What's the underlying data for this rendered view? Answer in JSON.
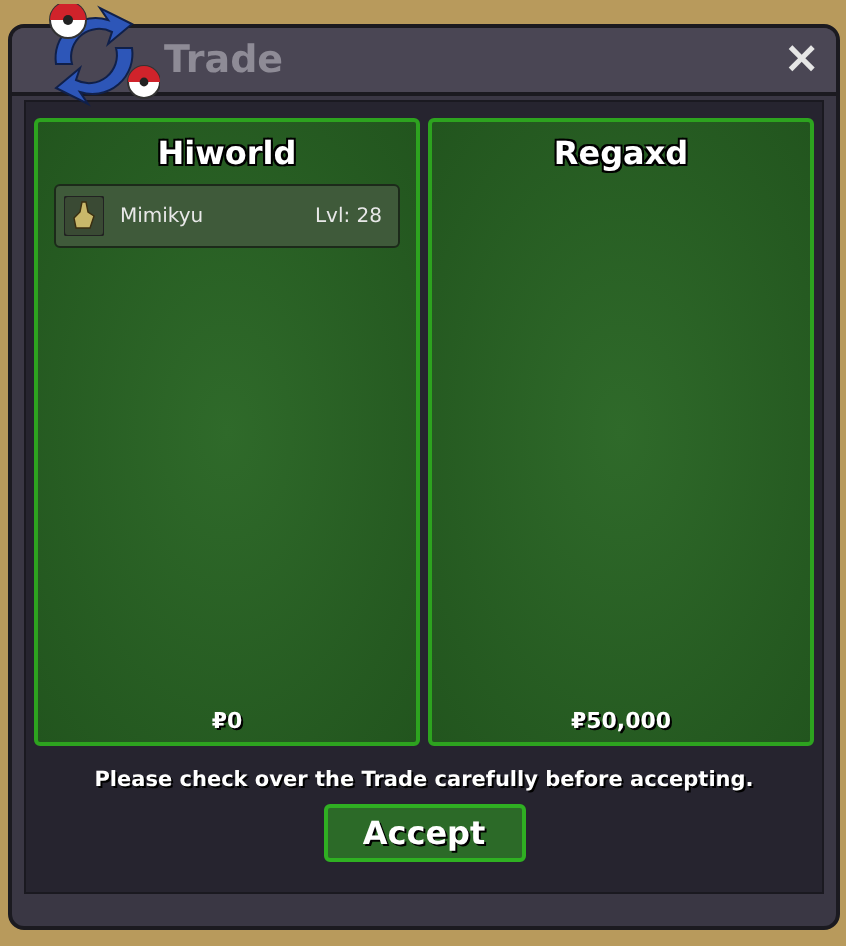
{
  "window": {
    "title": "Trade",
    "close": "×"
  },
  "traders": [
    {
      "name": "Hiworld",
      "money": "₽0",
      "items": [
        {
          "name": "Mimikyu",
          "level": "Lvl: 28"
        }
      ]
    },
    {
      "name": "Regaxd",
      "money": "₽50,000"
    }
  ],
  "notice": "Please check over the Trade carefully before accepting.",
  "accept_button": "Accept"
}
